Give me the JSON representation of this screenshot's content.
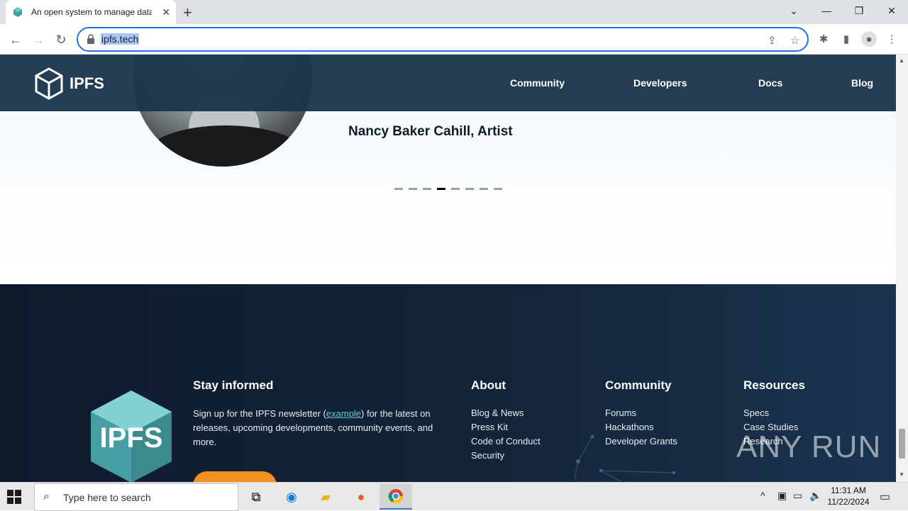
{
  "browser": {
    "tab_title": "An open system to manage data",
    "url": "ipfs.tech"
  },
  "site": {
    "logo_text": "IPFS",
    "nav": [
      "Community",
      "Developers",
      "Docs",
      "Blog"
    ],
    "testimonial_name": "Nancy Baker Cahill, Artist",
    "carousel": {
      "count": 8,
      "active_index": 3
    }
  },
  "footer": {
    "stay_informed": {
      "heading": "Stay informed",
      "text_before": "Sign up for the IPFS newsletter (",
      "link": "example",
      "text_after": ") for the latest on releases, upcoming developments, community events, and more."
    },
    "about": {
      "heading": "About",
      "links": [
        "Blog & News",
        "Press Kit",
        "Code of Conduct",
        "Security"
      ]
    },
    "community": {
      "heading": "Community",
      "links": [
        "Forums",
        "Hackathons",
        "Developer Grants"
      ]
    },
    "resources": {
      "heading": "Resources",
      "links": [
        "Specs",
        "Case Studies",
        "Research"
      ]
    },
    "cube_text": "IPFS",
    "watermark": "ANY RUN"
  },
  "taskbar": {
    "search_placeholder": "Type here to search",
    "time": "11:31 AM",
    "date": "11/22/2024"
  },
  "colors": {
    "header_bg": "#1a344a",
    "footer_bg": "#0e1a2c",
    "accent_teal": "#6bc4ce",
    "cta_orange": "#f39021",
    "omnibox_focus": "#1a73e8"
  }
}
